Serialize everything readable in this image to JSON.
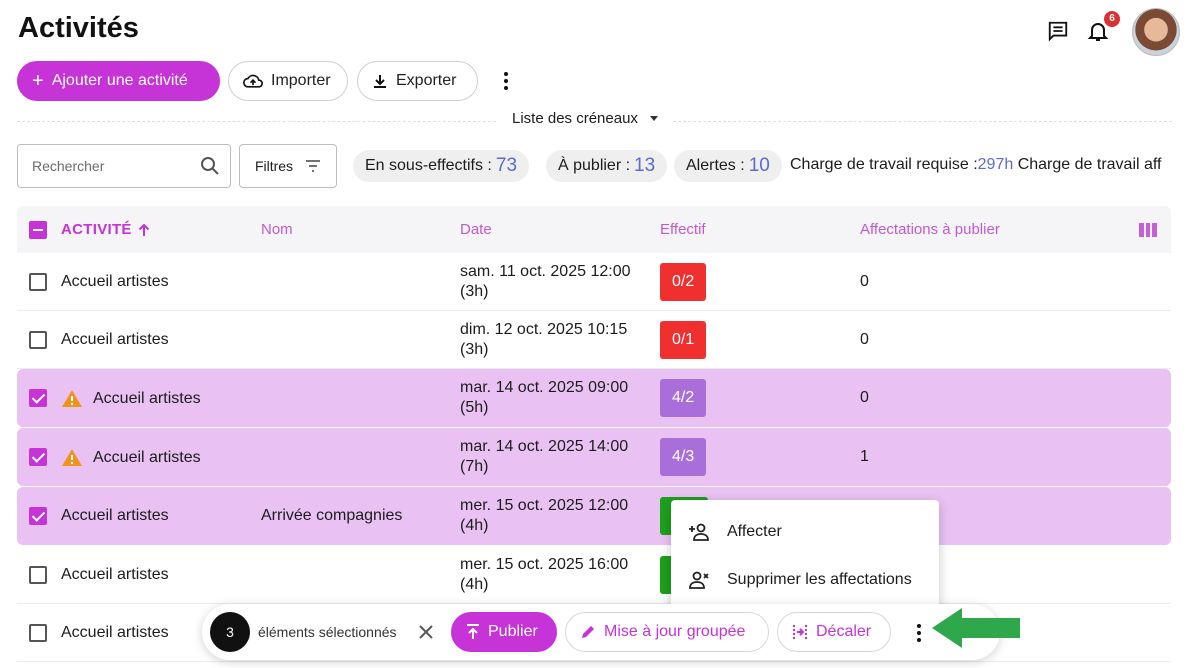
{
  "header": {
    "title": "Activités",
    "notifications_count": "6"
  },
  "toolbar": {
    "add_label": "Ajouter une activité",
    "import_label": "Importer",
    "export_label": "Exporter"
  },
  "view": {
    "selected": "Liste des créneaux"
  },
  "search": {
    "placeholder": "Rechercher"
  },
  "filters": {
    "label": "Filtres"
  },
  "stats": {
    "under_staffed_label": "En sous-effectifs :",
    "under_staffed_value": "73",
    "to_publish_label": "À publier :",
    "to_publish_value": "13",
    "alerts_label": "Alertes :",
    "alerts_value": "10",
    "charge_label": "Charge de travail requise :",
    "charge_value": "297h",
    "charge_assigned_label": "Charge de travail aff"
  },
  "table": {
    "columns": [
      "ACTIVITÉ",
      "Nom",
      "Date",
      "Effectif",
      "Affectations à publier"
    ],
    "rows": [
      {
        "activity": "Accueil artistes",
        "name": "",
        "date": "sam. 11 oct. 2025 12:00",
        "duration": "(3h)",
        "staff": "0/2",
        "pending": "0",
        "selected": false,
        "warning": false,
        "badge": "red"
      },
      {
        "activity": "Accueil artistes",
        "name": "",
        "date": "dim. 12 oct. 2025 10:15",
        "duration": "(3h)",
        "staff": "0/1",
        "pending": "0",
        "selected": false,
        "warning": false,
        "badge": "red"
      },
      {
        "activity": "Accueil artistes",
        "name": "",
        "date": "mar. 14 oct. 2025 09:00",
        "duration": "(5h)",
        "staff": "4/2",
        "pending": "0",
        "selected": true,
        "warning": true,
        "badge": "purple"
      },
      {
        "activity": "Accueil artistes",
        "name": "",
        "date": "mar. 14 oct. 2025 14:00",
        "duration": "(7h)",
        "staff": "4/3",
        "pending": "1",
        "selected": true,
        "warning": true,
        "badge": "purple"
      },
      {
        "activity": "Accueil artistes",
        "name": "Arrivée compagnies",
        "date": "mer. 15 oct. 2025 12:00",
        "duration": "(4h)",
        "staff": "",
        "pending": "",
        "selected": true,
        "warning": false,
        "badge": "green"
      },
      {
        "activity": "Accueil artistes",
        "name": "",
        "date": "mer. 15 oct. 2025 16:00",
        "duration": "(4h)",
        "staff": "",
        "pending": "",
        "selected": false,
        "warning": false,
        "badge": "green"
      },
      {
        "activity": "Accueil artistes",
        "name": "",
        "date": "",
        "duration": "",
        "staff": "",
        "pending": "",
        "selected": false,
        "warning": false,
        "badge": ""
      }
    ]
  },
  "selection_bar": {
    "count": "3",
    "label": "éléments sélectionnés",
    "publish_label": "Publier",
    "bulk_update_label": "Mise à jour groupée",
    "shift_label": "Décaler"
  },
  "context_menu": {
    "items": [
      "Affecter",
      "Supprimer les affectations"
    ]
  },
  "colors": {
    "accent": "#c633d6",
    "selected_row": "#e9c2f3",
    "badge_red": "#f0302e",
    "badge_purple": "#a96ed9",
    "badge_green": "#1da11d",
    "arrow": "#2ea84a"
  }
}
